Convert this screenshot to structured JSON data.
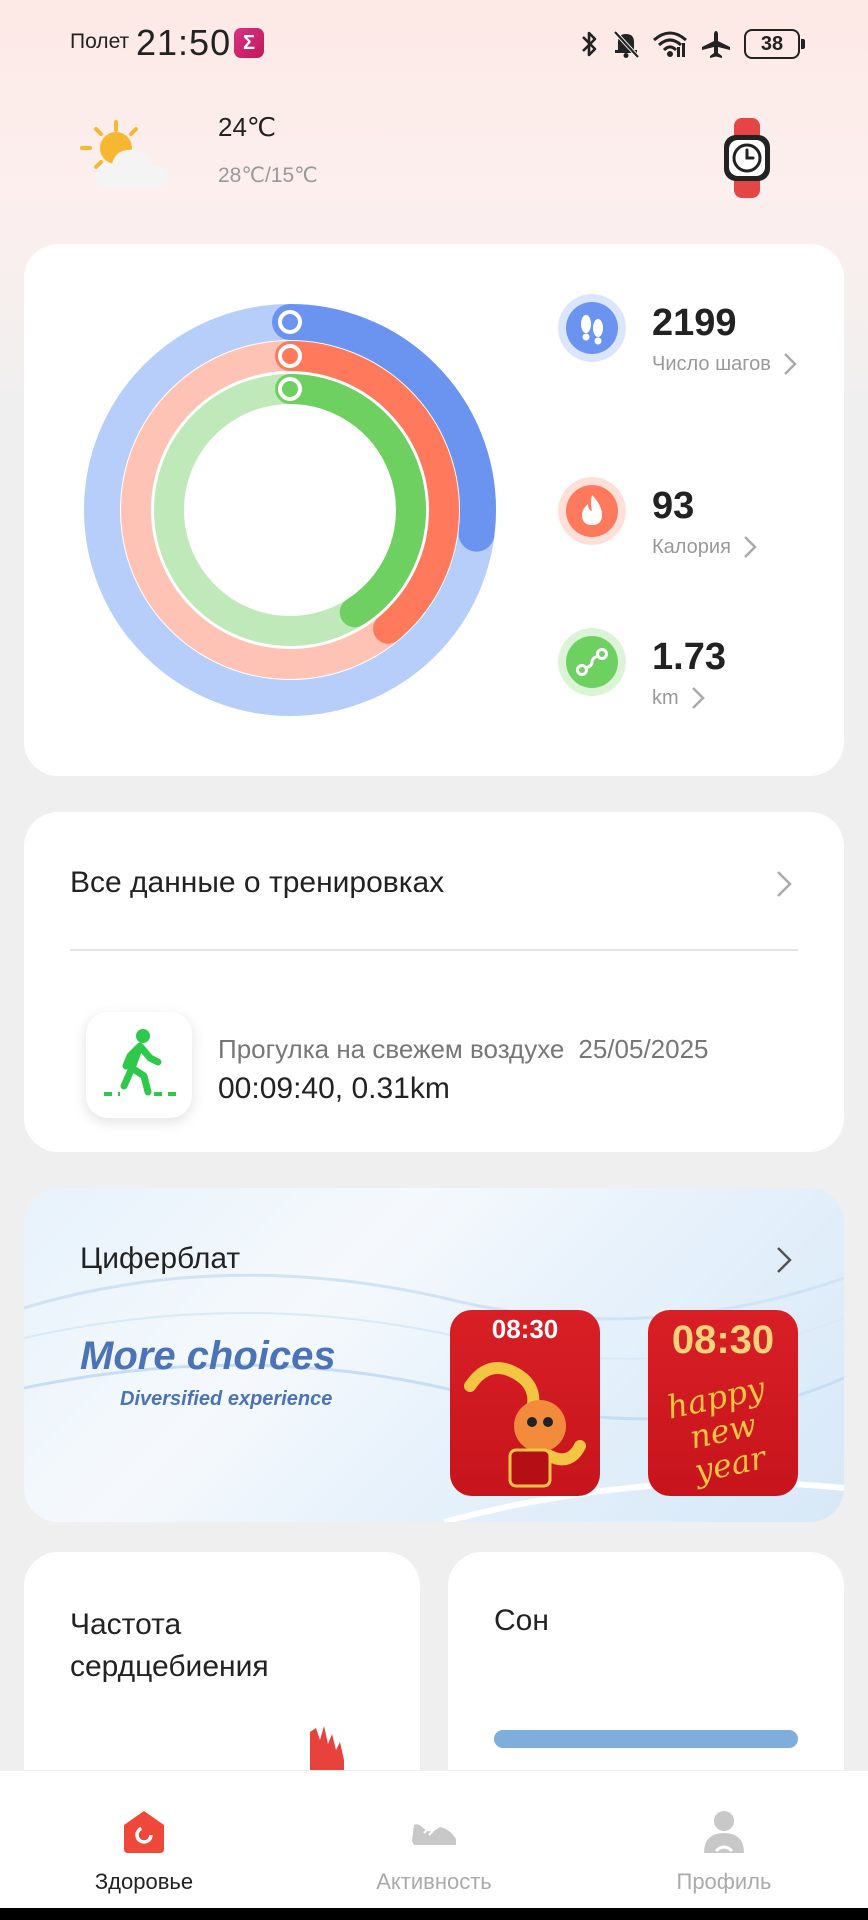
{
  "status_bar": {
    "mode": "Полет",
    "time": "21:50",
    "app_badge": "Σ",
    "battery": "38",
    "icons": [
      "bluetooth-icon",
      "bell-muted-icon",
      "wifi-icon",
      "airplane-icon",
      "battery-icon"
    ]
  },
  "weather": {
    "temp": "24℃",
    "range": "28℃/15℃",
    "icon": "partly-cloudy-icon"
  },
  "activity": {
    "steps": {
      "value": "2199",
      "label": "Число шагов",
      "progress": 0.27,
      "color": "#6b94f0"
    },
    "calories": {
      "value": "93",
      "label": "Калория",
      "progress": 0.39,
      "color": "#ff7a5c"
    },
    "distance": {
      "value": "1.73",
      "label": "km",
      "progress": 0.41,
      "color": "#6fd062"
    }
  },
  "workouts": {
    "title": "Все данные о тренировках",
    "latest": {
      "name": "Прогулка на свежем воздухе",
      "date": "25/05/2025",
      "stats": "00:09:40, 0.31km"
    }
  },
  "watch_faces": {
    "title": "Циферблат",
    "promo_title": "More choices",
    "promo_subtitle": "Diversified experience",
    "faces": [
      {
        "time": "08:30"
      },
      {
        "time": "08:30",
        "caption": "happy new year"
      }
    ]
  },
  "heart_rate": {
    "title": "Частота сердцебиения"
  },
  "sleep": {
    "title": "Сон"
  },
  "nav": {
    "items": [
      {
        "label": "Здоровье",
        "active": true
      },
      {
        "label": "Активность",
        "active": false
      },
      {
        "label": "Профиль",
        "active": false
      }
    ]
  }
}
